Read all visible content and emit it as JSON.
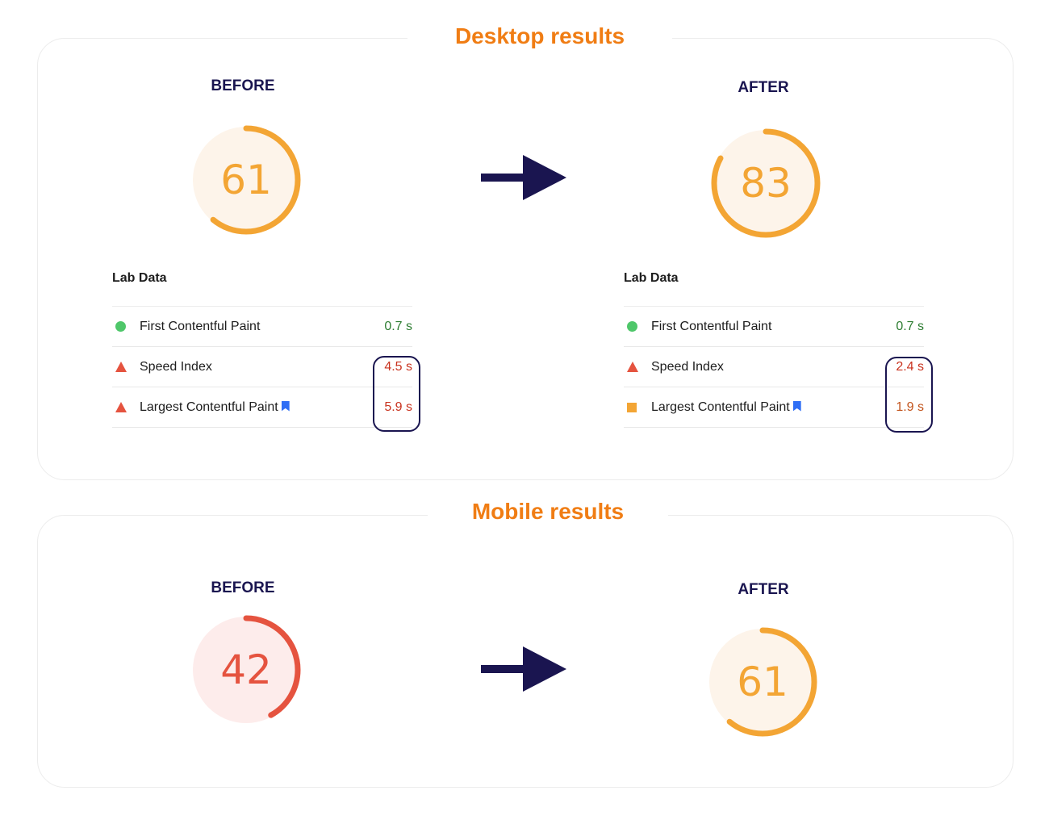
{
  "colors": {
    "title": "#f07d14",
    "label": "#1a1550",
    "average": "#f3a534",
    "poor": "#e5533f",
    "good": "#4fc76a",
    "average_bg": "#fdf4ea",
    "poor_bg": "#fdeceb"
  },
  "desktop": {
    "title": "Desktop results",
    "before": {
      "label": "BEFORE",
      "score": "61",
      "score_value": 61,
      "lab_title": "Lab Data",
      "metrics": [
        {
          "name": "First Contentful Paint",
          "value": "0.7 s",
          "status": "good"
        },
        {
          "name": "Speed Index",
          "value": "4.5 s",
          "status": "poor"
        },
        {
          "name": "Largest Contentful Paint",
          "value": "5.9 s",
          "status": "poor",
          "bookmark": true
        }
      ]
    },
    "after": {
      "label": "AFTER",
      "score": "83",
      "score_value": 83,
      "lab_title": "Lab Data",
      "metrics": [
        {
          "name": "First Contentful Paint",
          "value": "0.7 s",
          "status": "good"
        },
        {
          "name": "Speed Index",
          "value": "2.4 s",
          "status": "poor"
        },
        {
          "name": "Largest Contentful Paint",
          "value": "1.9 s",
          "status": "average",
          "bookmark": true
        }
      ]
    }
  },
  "mobile": {
    "title": "Mobile results",
    "before": {
      "label": "BEFORE",
      "score": "42",
      "score_value": 42
    },
    "after": {
      "label": "AFTER",
      "score": "61",
      "score_value": 61
    }
  },
  "icons": {
    "arrow": "arrow-right-icon",
    "good": "green-circle-icon",
    "poor": "red-triangle-icon",
    "average": "orange-square-icon",
    "bookmark": "bookmark-icon"
  }
}
